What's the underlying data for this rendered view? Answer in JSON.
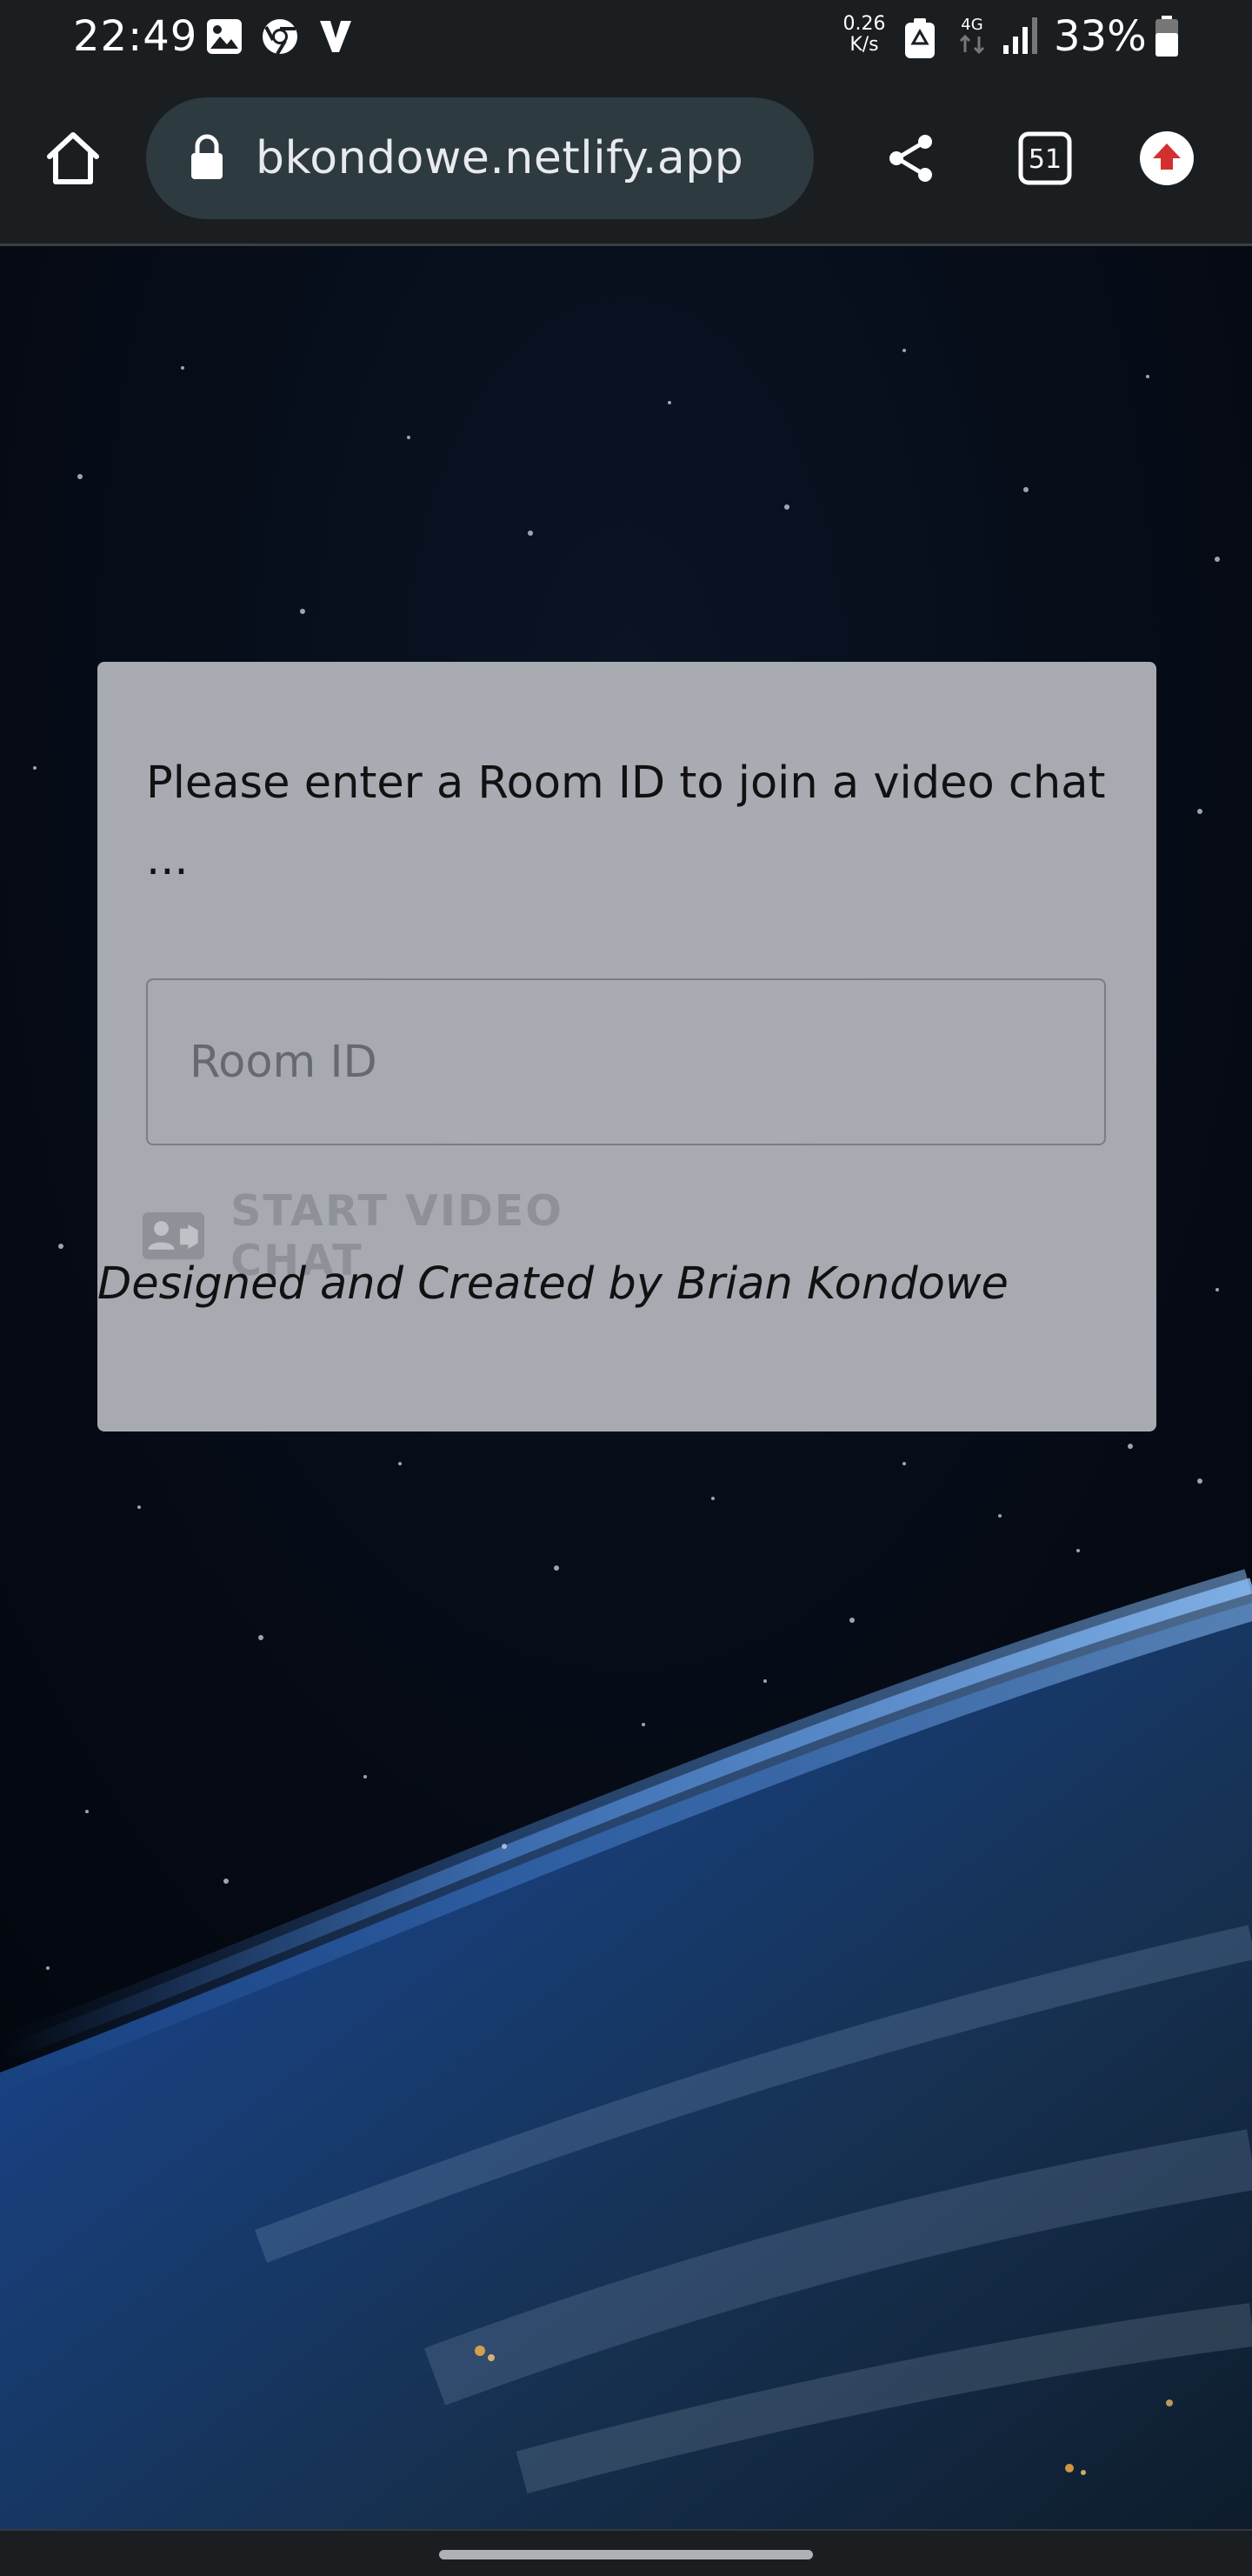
{
  "status_bar": {
    "time": "22:49",
    "net_speed_value": "0.26",
    "net_speed_unit": "K/s",
    "network_type": "4G",
    "battery_percent": "33%",
    "left_icons": [
      "gallery-icon",
      "chrome-icon",
      "v-app-icon"
    ],
    "right_icons": [
      "battery-saver-icon",
      "network-4g-icon",
      "signal-icon",
      "battery-icon"
    ]
  },
  "browser": {
    "url": "bkondowe.netlify.app",
    "tab_count": "51",
    "icons": [
      "home-icon",
      "lock-icon",
      "share-icon",
      "tab-switcher-icon",
      "update-icon"
    ],
    "accent": "#d32f2f"
  },
  "page": {
    "prompt_line1": "Please enter a Room ID to join a video chat",
    "prompt_line2": "...",
    "room_input": {
      "placeholder": "Room ID",
      "value": ""
    },
    "start_button": {
      "label": "START VIDEO CHAT",
      "icon": "video-contact-icon"
    },
    "credit": "Designed and Created by Brian Kondowe"
  }
}
